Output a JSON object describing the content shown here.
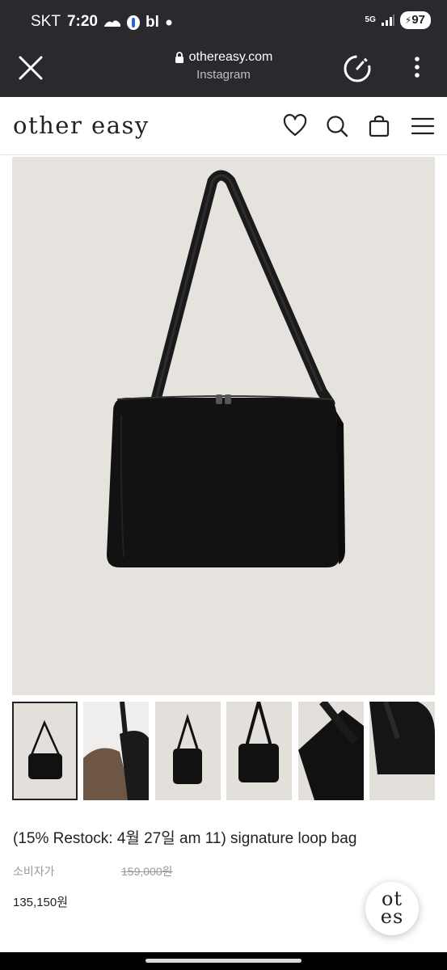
{
  "status_bar": {
    "carrier": "SKT",
    "time": "7:20",
    "extra_text": "bl",
    "network": "5G",
    "battery": "97"
  },
  "browser": {
    "url": "othereasy.com",
    "source": "Instagram",
    "icons": [
      "close-icon",
      "lock-icon",
      "speed-icon",
      "more-vertical-icon"
    ]
  },
  "site": {
    "logo": "other easy",
    "icons": [
      "heart-icon",
      "search-icon",
      "bag-icon",
      "hamburger-menu-icon"
    ]
  },
  "product": {
    "title": "(15% Restock: 4월 27일 am 11) signature loop bag",
    "price_label": "소비자가",
    "original_price": "159,000원",
    "sale_price": "135,150원",
    "thumbnail_count": 6,
    "selected_thumbnail": 1
  },
  "fab": {
    "line1": "ot",
    "line2": "es"
  },
  "colors": {
    "browser_bar": "#2a2a2e",
    "image_bg": "#e6e3df",
    "bag": "#111111",
    "text": "#222222",
    "muted": "#999999"
  }
}
